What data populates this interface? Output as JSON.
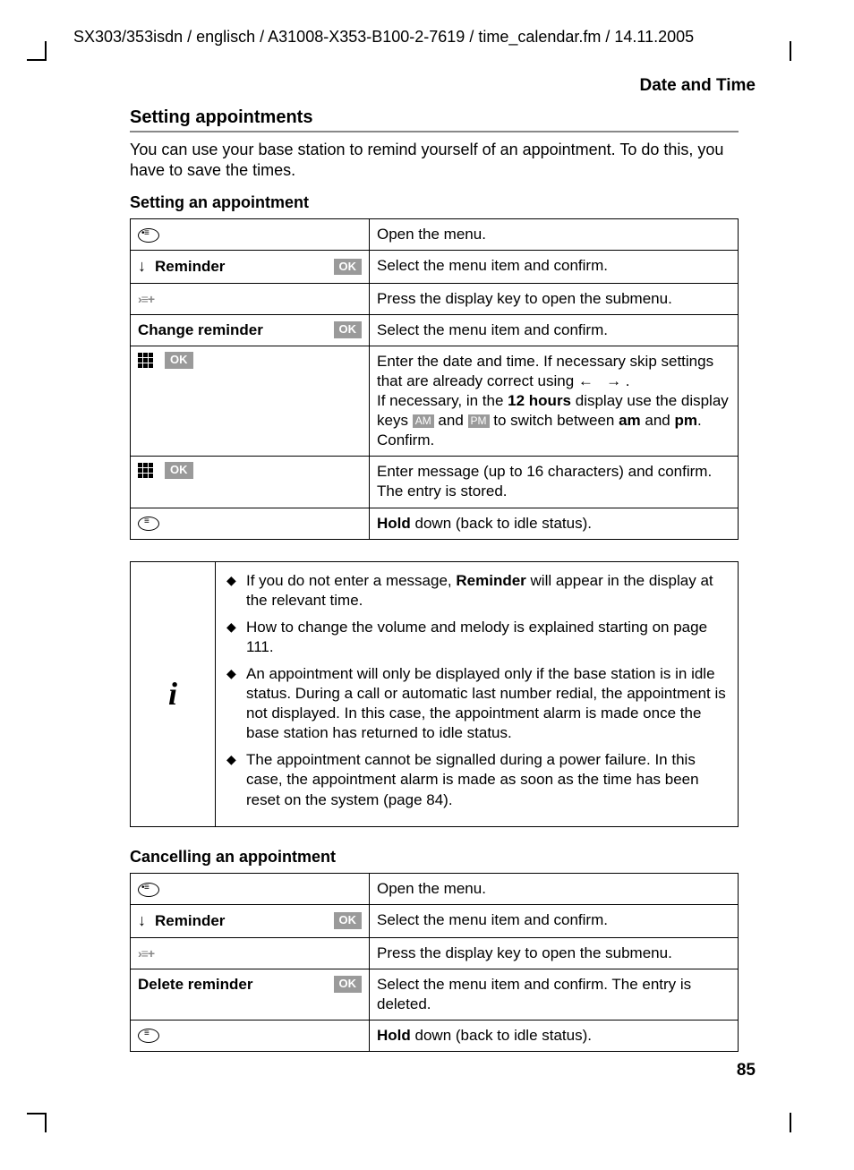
{
  "header_path": "SX303/353isdn / englisch / A31008-X353-B100-2-7619 / time_calendar.fm / 14.11.2005",
  "page_title": "Date and Time",
  "section_heading": "Setting appointments",
  "intro": "You can use your base station to remind yourself of an appointment. To do this, you have to save the times.",
  "sub1": "Setting an appointment",
  "badges": {
    "ok": "OK",
    "am": "AM",
    "pm": "PM"
  },
  "t1": {
    "r1_desc": "Open the menu.",
    "r2_label": "Reminder",
    "r2_desc": "Select the menu item and confirm.",
    "r3_desc": "Press the display key to open the submenu.",
    "r4_label": "Change reminder",
    "r4_desc": "Select the menu item and confirm.",
    "r5_desc_a": "Enter the date and time. If necessary skip settings that are already correct using ",
    "r5_desc_b": "If necessary, in the ",
    "r5_desc_b_bold": "12 hours",
    "r5_desc_b2": " display use the display keys ",
    "r5_desc_b3": " and ",
    "r5_desc_b4": " to switch between ",
    "r5_desc_b_am": "am",
    "r5_desc_b_and": " and ",
    "r5_desc_b_pm": "pm",
    "r5_desc_b5": ". Confirm.",
    "r6_desc": "Enter message (up to 16 characters) and confirm. The entry is stored.",
    "r7_bold": "Hold",
    "r7_desc": " down (back to idle status)."
  },
  "info": {
    "i1a": "If you do not enter a message, ",
    "i1b": "Reminder",
    "i1c": " will appear in the display at the relevant time.",
    "i2": "How to change the volume and melody is explained starting on page 111.",
    "i3": "An appointment will only be displayed only if the base station is in idle status. During a call or automatic last number redial, the appointment is not displayed. In this case, the appointment alarm is made once the base station has returned to idle status.",
    "i4": "The appointment cannot be signalled during a power failure. In this case, the appointment alarm is made as soon as the time has been reset on the system (page 84)."
  },
  "sub2": "Cancelling an appointment",
  "t2": {
    "r1_desc": "Open the menu.",
    "r2_label": "Reminder",
    "r2_desc": "Select the menu item and confirm.",
    "r3_desc": "Press the display key to open the submenu.",
    "r4_label": "Delete reminder",
    "r4_desc": "Select the menu item and confirm. The entry is deleted.",
    "r5_bold": "Hold",
    "r5_desc": " down (back to idle status)."
  },
  "page_number": "85"
}
